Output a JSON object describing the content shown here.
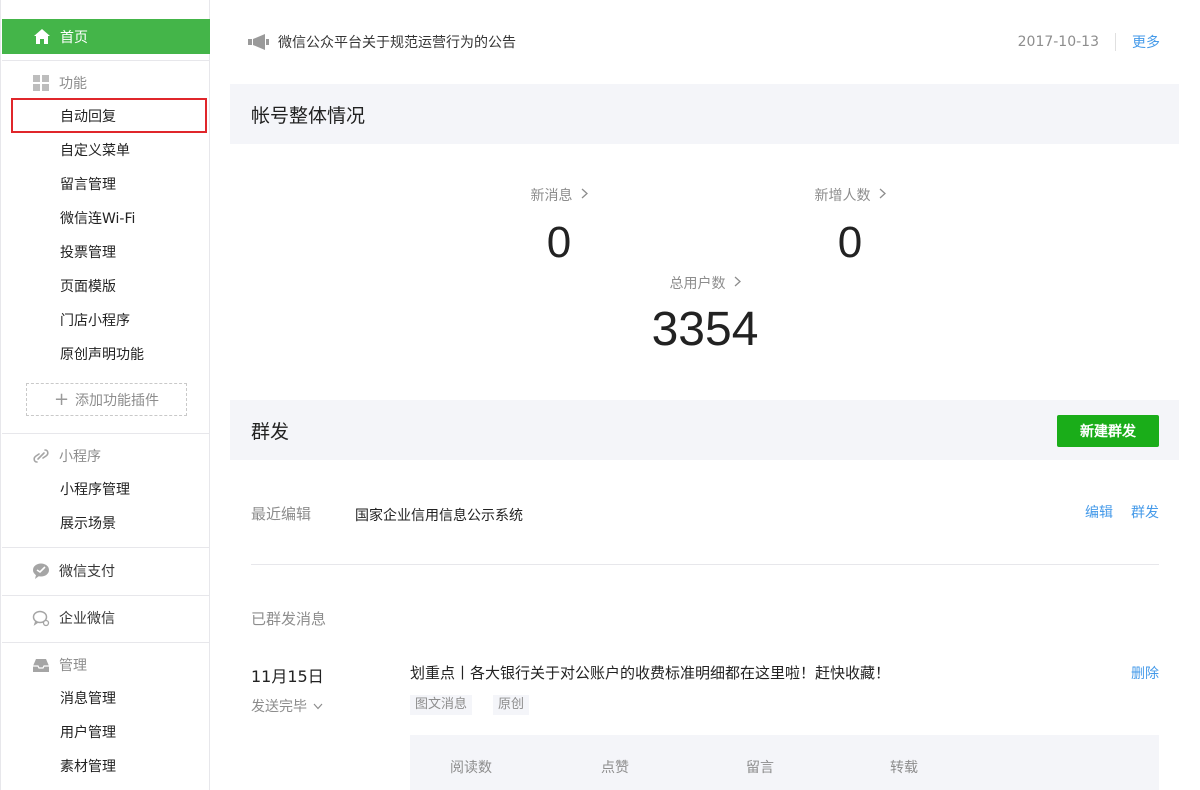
{
  "sidebar": {
    "home_label": "首页",
    "function_section": {
      "label": "功能",
      "items": [
        "自动回复",
        "自定义菜单",
        "留言管理",
        "微信连Wi-Fi",
        "投票管理",
        "页面模版",
        "门店小程序",
        "原创声明功能"
      ],
      "add_plugin_label": "添加功能插件"
    },
    "miniprogram_section": {
      "label": "小程序",
      "items": [
        "小程序管理",
        "展示场景"
      ]
    },
    "pay_label": "微信支付",
    "work_label": "企业微信",
    "manage_section": {
      "label": "管理",
      "items": [
        "消息管理",
        "用户管理",
        "素材管理"
      ]
    }
  },
  "notice": {
    "text": "微信公众平台关于规范运营行为的公告",
    "date": "2017-10-13",
    "more_label": "更多"
  },
  "overview": {
    "title": "帐号整体情况",
    "new_messages_label": "新消息",
    "new_messages_value": "0",
    "new_users_label": "新增人数",
    "new_users_value": "0",
    "total_users_label": "总用户数",
    "total_users_value": "3354"
  },
  "broadcast": {
    "title": "群发",
    "new_button_label": "新建群发",
    "recent_label": "最近编辑",
    "recent_title": "国家企业信用信息公示系统",
    "edit_label": "编辑",
    "send_label": "群发",
    "sent_label": "已群发消息",
    "message": {
      "date": "11月15日",
      "status": "发送完毕",
      "title": "划重点丨各大银行关于对公账户的收费标准明细都在这里啦！赶快收藏！",
      "tags": [
        "图文消息",
        "原创"
      ],
      "delete_label": "删除",
      "stat_columns": [
        "阅读数",
        "点赞",
        "留言",
        "转载"
      ]
    }
  },
  "colors": {
    "accent_green": "#44b549",
    "button_green": "#1aad19",
    "link_blue": "#459ae9",
    "highlight_red": "#e0262b"
  }
}
